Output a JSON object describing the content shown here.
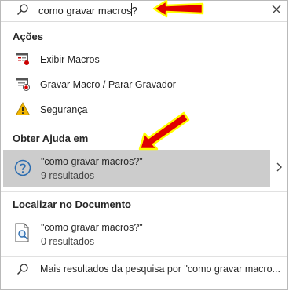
{
  "search": {
    "value": "como gravar macros?"
  },
  "actions": {
    "title": "Ações",
    "items": [
      {
        "label": "Exibir Macros",
        "icon": "macros-list-icon"
      },
      {
        "label": "Gravar Macro / Parar Gravador",
        "icon": "record-macro-icon"
      },
      {
        "label": "Segurança",
        "icon": "warning-icon"
      }
    ]
  },
  "help": {
    "title": "Obter Ajuda em",
    "result_title": "\"como gravar macros?\"",
    "result_count": "9 resultados"
  },
  "document": {
    "title": "Localizar no Documento",
    "result_title": "\"como gravar macros?\"",
    "result_count": "0 resultados"
  },
  "more": {
    "label": "Mais resultados da pesquisa por \"como gravar macro..."
  },
  "colors": {
    "highlight": "#cccccc",
    "arrow_fill": "#e00000",
    "arrow_outline": "#ffff00",
    "accent_blue": "#2b6cb0"
  }
}
